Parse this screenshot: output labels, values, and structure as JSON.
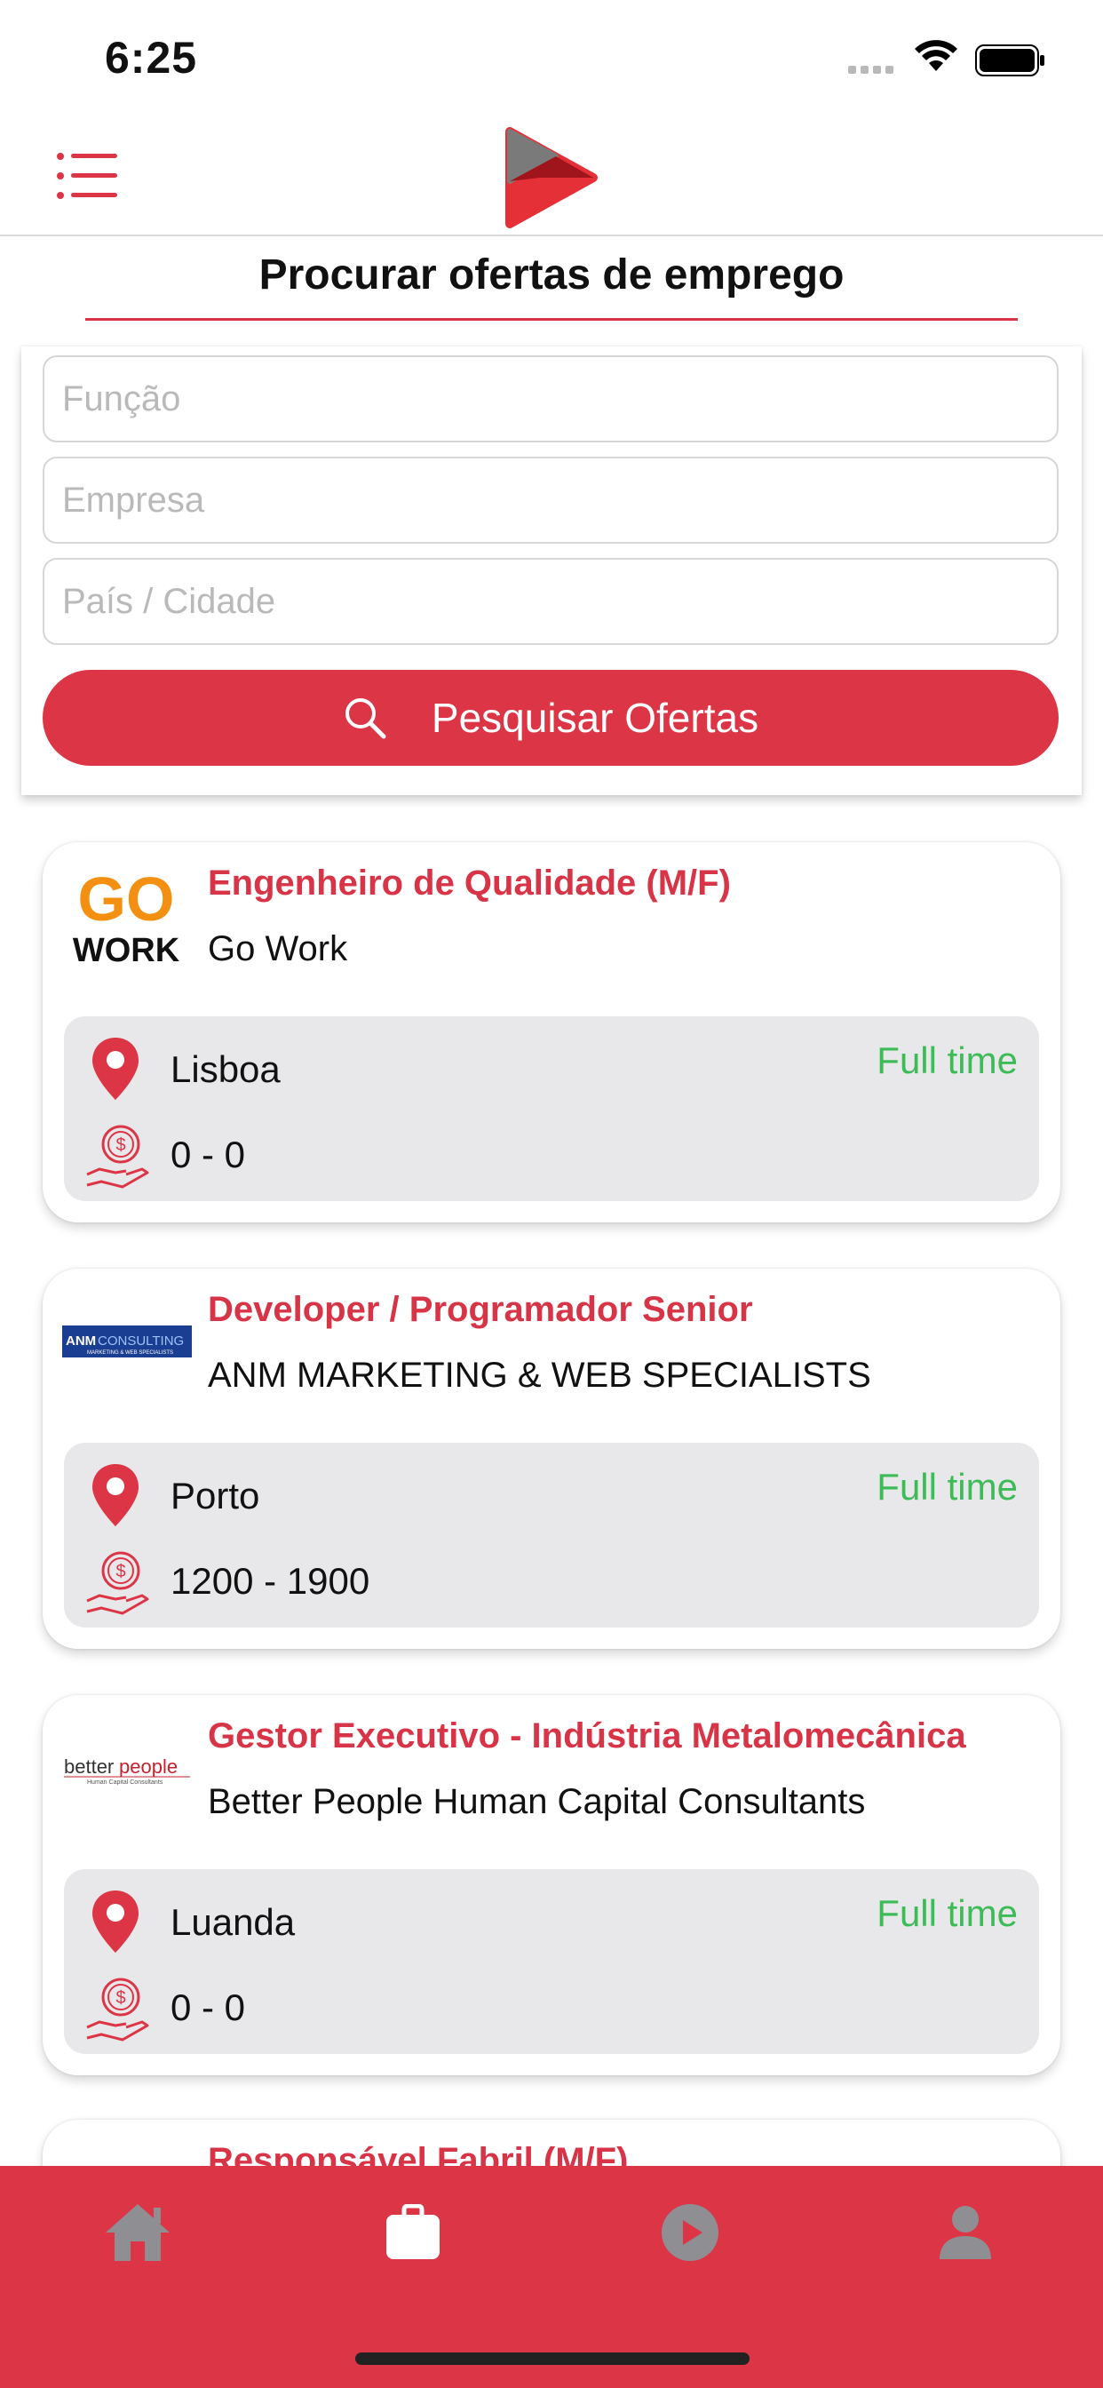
{
  "status_bar": {
    "time": "6:25"
  },
  "header": {
    "title": "Procurar ofertas de emprego"
  },
  "search": {
    "role_placeholder": "Função",
    "company_placeholder": "Empresa",
    "location_placeholder": "País / Cidade",
    "button_label": "Pesquisar Ofertas"
  },
  "jobs": [
    {
      "title": "Engenheiro de Qualidade (M/F)",
      "company": "Go Work",
      "location": "Lisboa",
      "salary": "0 - 0",
      "type": "Full time",
      "logo_text_1": "GO",
      "logo_text_2": "WORK"
    },
    {
      "title": "Developer / Programador Senior",
      "company": "ANM MARKETING & WEB SPECIALISTS",
      "location": "Porto",
      "salary": "1200 - 1900",
      "type": "Full time",
      "logo_text_1": "ANM",
      "logo_text_2": "CONSULTING",
      "logo_text_3": "MARKETING & WEB SPECIALISTS"
    },
    {
      "title": "Gestor Executivo - Indústria Metalomecânica",
      "company": "Better People Human Capital Consultants",
      "location": "Luanda",
      "salary": "0 - 0",
      "type": "Full time",
      "logo_text_1": "better",
      "logo_text_2": "people",
      "logo_text_3": "Human Capital Consultants"
    }
  ],
  "partial_job": {
    "title": "Responsável Fabril (M/F)"
  },
  "tabs": [
    "home-icon",
    "briefcase-icon",
    "play-icon",
    "user-icon"
  ],
  "colors": {
    "accent": "#dc3546",
    "job_type": "#3dbb57",
    "details_bg": "#e8e8ea",
    "tab_inactive": "#8e8e93"
  }
}
